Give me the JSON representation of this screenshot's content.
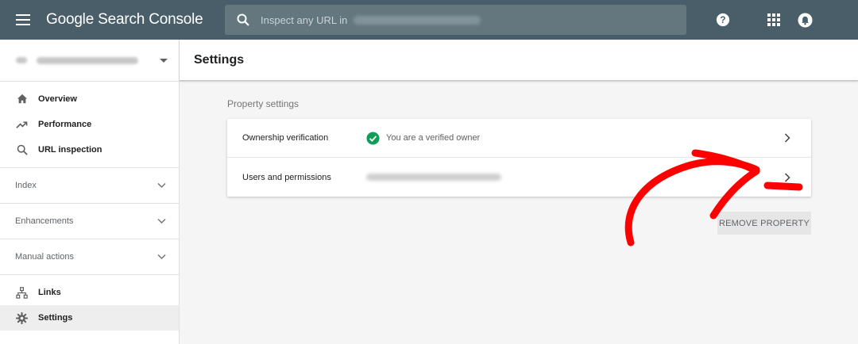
{
  "header": {
    "brand": "Google Search Console",
    "search_placeholder": "Inspect any URL in"
  },
  "sidebar": {
    "nav_items": [
      {
        "label": "Overview",
        "icon": "home-icon"
      },
      {
        "label": "Performance",
        "icon": "trending-up-icon"
      },
      {
        "label": "URL inspection",
        "icon": "search-icon"
      }
    ],
    "sections": [
      {
        "label": "Index"
      },
      {
        "label": "Enhancements"
      },
      {
        "label": "Manual actions"
      }
    ],
    "bottom_items": [
      {
        "label": "Links",
        "icon": "links-icon"
      },
      {
        "label": "Settings",
        "icon": "gear-icon",
        "active": true
      }
    ]
  },
  "main": {
    "title": "Settings",
    "section_heading": "Property settings",
    "rows": [
      {
        "label": "Ownership verification",
        "value": "You are a verified owner"
      },
      {
        "label": "Users and permissions"
      }
    ],
    "remove_button": "REMOVE PROPERTY"
  },
  "colors": {
    "topbar": "#4a5e69",
    "search": "#64777f",
    "verified_green": "#0f9d58",
    "annotation_red": "#ff0000"
  }
}
